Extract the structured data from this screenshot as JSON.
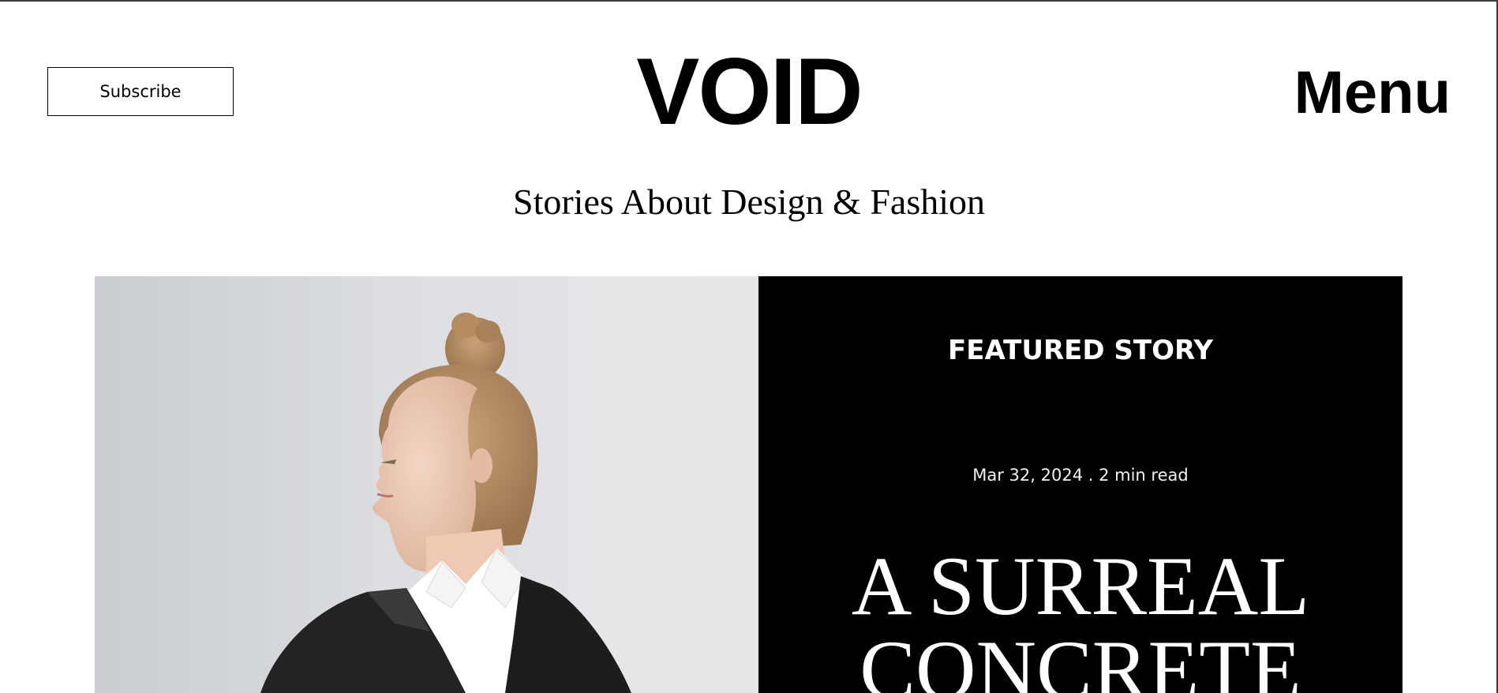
{
  "header": {
    "subscribe_label": "Subscribe",
    "logo_text": "VOID",
    "menu_label": "Menu"
  },
  "tagline": "Stories About Design & Fashion",
  "featured": {
    "label": "FEATURED STORY",
    "meta": "Mar 32, 2024 . 2 min read",
    "title_line1": "A SURREAL",
    "title_line2": "CONCRETE",
    "image_icon": "woman-portrait-photo"
  },
  "colors": {
    "background": "#ffffff",
    "panel": "#000000",
    "text": "#000000",
    "panel_text": "#ffffff"
  }
}
